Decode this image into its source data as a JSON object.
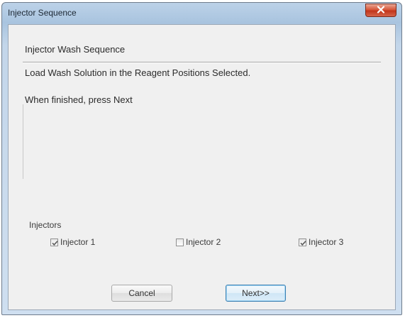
{
  "window": {
    "title": "Injector Sequence"
  },
  "content": {
    "header": "Injector Wash Sequence",
    "instruction": "Load Wash Solution in the Reagent Positions Selected.",
    "prompt": "When finished, press Next"
  },
  "injectors": {
    "group_label": "Injectors",
    "items": [
      {
        "label": "Injector 1",
        "checked": true
      },
      {
        "label": "Injector 2",
        "checked": false
      },
      {
        "label": "Injector 3",
        "checked": true
      }
    ]
  },
  "buttons": {
    "cancel_label": "Cancel",
    "next_label": "Next>>"
  },
  "colors": {
    "titlebar": "#a9c4df",
    "close_button": "#c9452a",
    "client_background": "#f0f0f0",
    "default_button_border": "#3c7fb1"
  },
  "icons": {
    "close": "close-icon",
    "check": "checkmark-icon"
  }
}
